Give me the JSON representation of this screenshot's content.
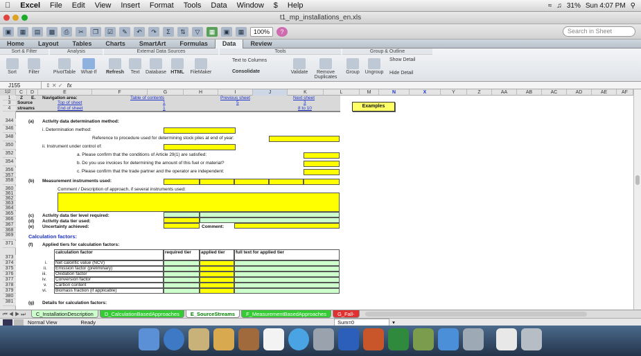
{
  "menubar": {
    "apple": "",
    "app": "Excel",
    "items": [
      "File",
      "Edit",
      "View",
      "Insert",
      "Format",
      "Tools",
      "Data",
      "Window",
      "$",
      "Help"
    ],
    "battery": "31%",
    "clock": "Sun 4:07 PM"
  },
  "window": {
    "title": "t1_mp_installations_en.xls"
  },
  "toolbar": {
    "zoom": "100%",
    "search_placeholder": "Search in Sheet"
  },
  "ribbon": {
    "tabs": [
      "Home",
      "Layout",
      "Tables",
      "Charts",
      "SmartArt",
      "Formulas",
      "Data",
      "Review"
    ],
    "active_tab": "Data",
    "groups": {
      "sort_filter": {
        "title": "Sort & Filter",
        "sort": "Sort",
        "filter": "Filter"
      },
      "analysis": {
        "title": "Analysis",
        "pivot": "PivotTable",
        "whatif": "What-If"
      },
      "external": {
        "title": "External Data Sources",
        "refresh": "Refresh",
        "text": "Text",
        "database": "Database",
        "html": "HTML",
        "filemaker": "FileMaker"
      },
      "tools": {
        "title": "Tools",
        "text_to_columns": "Text to Columns",
        "consolidate": "Consolidate",
        "validate": "Validate",
        "remove_dup1": "Remove",
        "remove_dup2": "Duplicates"
      },
      "group_outline": {
        "title": "Group & Outline",
        "group": "Group",
        "ungroup": "Ungroup",
        "show_detail": "Show Detail",
        "hide_detail": "Hide Detail"
      }
    }
  },
  "formula": {
    "namebox": "J155",
    "fx": "fx",
    "value": ""
  },
  "columns": [
    "C",
    "D",
    "E",
    "F",
    "G",
    "H",
    "I",
    "J",
    "K",
    "L",
    "M",
    "N",
    "X",
    "Y",
    "Z",
    "AA",
    "AB",
    "AC",
    "AD",
    "AE",
    "AF"
  ],
  "selected_column": "J",
  "sheet": {
    "nav": {
      "z": "Z",
      "e": "E.",
      "source1": "Source",
      "source2": "streams",
      "navigation_area": "Navigation area:",
      "table_of_contents": "Table of contents",
      "previous_sheet": "Previous sheet",
      "next_sheet": "Next sheet",
      "top_of_sheet": "Top of sheet",
      "end_of_sheet": "End of sheet",
      "toc_num": "1",
      "prev_num": "5",
      "next_num": "3",
      "next_num2": "8 to 10",
      "toc_num2": "1"
    },
    "examples_button": "Examples",
    "rows": [
      "1",
      "3",
      "4",
      "344",
      "346",
      "348",
      "350",
      "352",
      "354",
      "356",
      "357",
      "358",
      "360",
      "361",
      "362",
      "363",
      "364",
      "365",
      "366",
      "367",
      "368",
      "369",
      "371",
      "373",
      "374",
      "375",
      "376",
      "377",
      "378",
      "379",
      "380",
      "381"
    ],
    "a_label": "(a)",
    "a_title": "Activity data determination method:",
    "i_det": "i. Determination method:",
    "ref_proc": "Reference to procedure used for determining stock piles at end of year:",
    "ii_instr": "ii. Instrument under control of:",
    "q_a": "a. Please confirm that the conditions of Article 29(1) are satisfied:",
    "q_b": "b. Do you use invoices for determining the amount of this fuel or material?",
    "q_c": "c. Please confirm that the trade partner and the operator are independent:",
    "b_label": "(b)",
    "b_title": "Measurement instruments used:",
    "comment_desc": "Comment / Description of approach, if several instruments used:",
    "c_label": "(c)",
    "c_text": "Activity data tier level required:",
    "d_label": "(d)",
    "d_text": "Activity data tier used:",
    "e_label": "(e)",
    "e_text": "Uncertainty achieved:",
    "comment_label": "Comment:",
    "calc_factors": "Calculation factors:",
    "f_label": "(f)",
    "f_title": "Applied tiers for calculation factors:",
    "table_headers": [
      "calculation factor",
      "required tier",
      "applied tier",
      "full text for applied tier"
    ],
    "factors": [
      {
        "num": "i.",
        "name": "Net calorific value (NCV)"
      },
      {
        "num": "ii.",
        "name": "Emission factor (preliminary)"
      },
      {
        "num": "iii.",
        "name": "Oxidation factor"
      },
      {
        "num": "iv.",
        "name": "Conversion factor"
      },
      {
        "num": "v.",
        "name": "Carbon content"
      },
      {
        "num": "vi.",
        "name": "Biomass fraction (if applicable)"
      }
    ],
    "g_label": "(g)",
    "g_title": "Details for calculation factors:"
  },
  "sheet_tabs": [
    "C_InstallationDescription",
    "D_CalculationBasedApproaches",
    "E_SourceStreams",
    "F_MeasurementBasedApproaches",
    "G_Fall-"
  ],
  "active_sheet_tab": "E_SourceStreams",
  "status": {
    "view": "Normal View",
    "ready": "Ready",
    "sum": "Sum=0"
  },
  "colors": {
    "yellow": "#ffff00",
    "green": "#ccffcc",
    "link": "#1f33c8"
  }
}
